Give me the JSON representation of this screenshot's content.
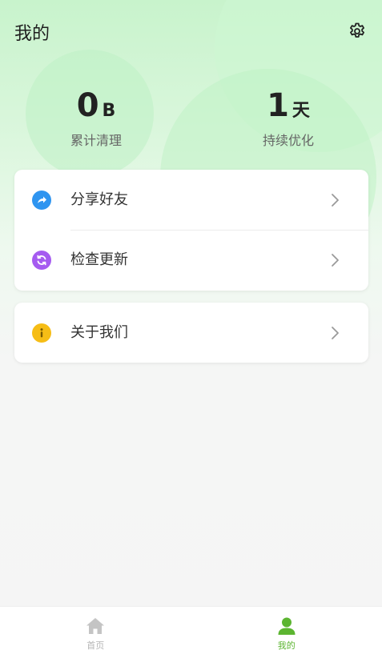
{
  "header": {
    "title": "我的",
    "settings_icon": "gear-icon"
  },
  "stats": [
    {
      "value": "0",
      "unit": "B",
      "label": "累计清理"
    },
    {
      "value": "1",
      "unit": "天",
      "label": "持续优化"
    }
  ],
  "menu": {
    "share": {
      "label": "分享好友",
      "icon": "share-icon",
      "color": "#2f95f0"
    },
    "update": {
      "label": "检查更新",
      "icon": "refresh-icon",
      "color": "#a55bf0"
    },
    "about": {
      "label": "关于我们",
      "icon": "info-icon",
      "color": "#f6bd16"
    }
  },
  "tabbar": {
    "home": {
      "label": "首页",
      "icon": "home-icon",
      "color": "#c4c4c4"
    },
    "mine": {
      "label": "我的",
      "icon": "user-icon",
      "color": "#5cb531"
    }
  },
  "colors": {
    "accent": "#5cb531",
    "header_gradient_top": "#c8f3cc"
  }
}
